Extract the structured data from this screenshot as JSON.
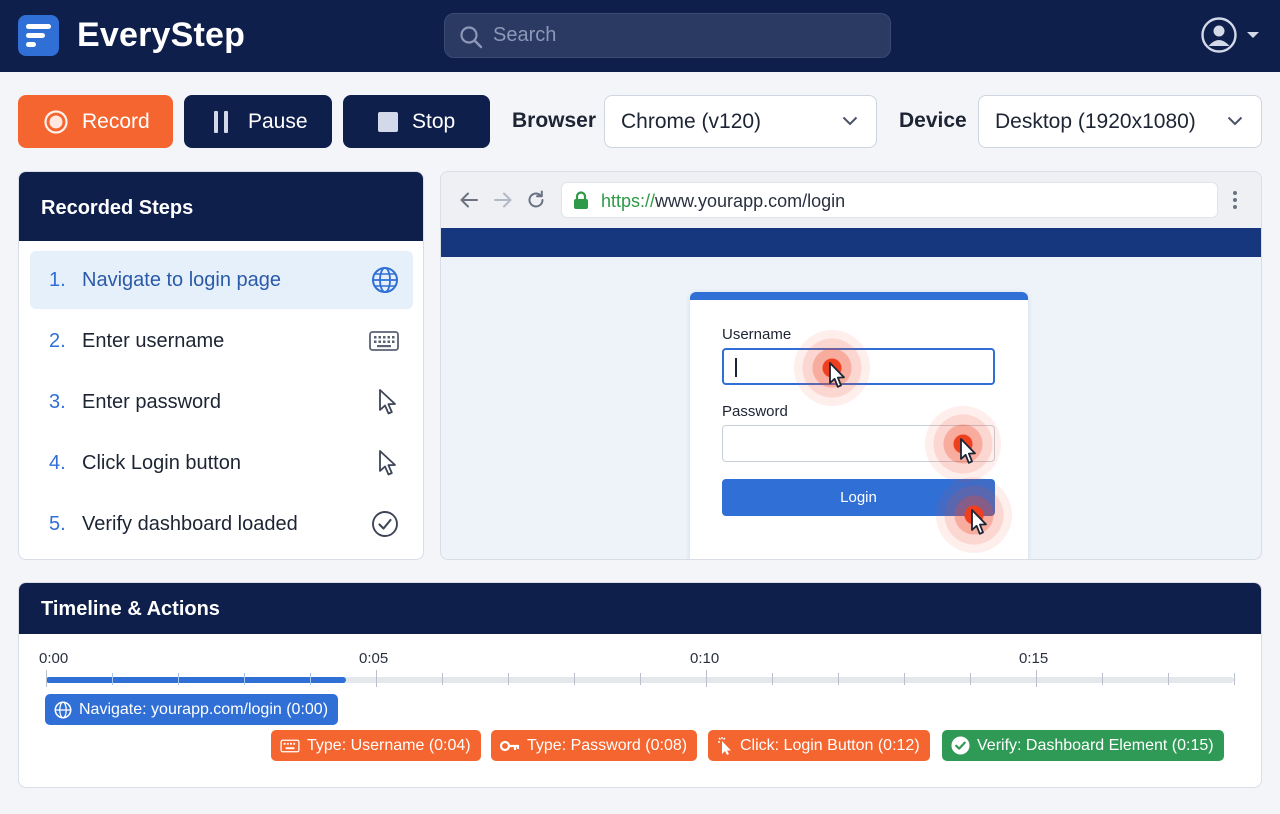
{
  "app": {
    "name": "EveryStep"
  },
  "header": {
    "search_placeholder": "Search"
  },
  "toolbar": {
    "record_label": "Record",
    "pause_label": "Pause",
    "stop_label": "Stop",
    "browser_label": "Browser",
    "browser_value": "Chrome (v120)",
    "device_label": "Device",
    "device_value": "Desktop (1920x1080)"
  },
  "steps": {
    "title": "Recorded Steps",
    "items": [
      {
        "num": "1.",
        "label": "Navigate to login page",
        "icon": "globe-icon",
        "active": true
      },
      {
        "num": "2.",
        "label": "Enter username",
        "icon": "keyboard-icon",
        "active": false
      },
      {
        "num": "3.",
        "label": "Enter password",
        "icon": "cursor-icon",
        "active": false
      },
      {
        "num": "4.",
        "label": "Click Login button",
        "icon": "cursor-icon",
        "active": false
      },
      {
        "num": "5.",
        "label": "Verify dashboard loaded",
        "icon": "check-circle-icon",
        "active": false
      }
    ]
  },
  "preview": {
    "url_scheme": "https://",
    "url_rest": "www.yourapp.com/login",
    "username_label": "Username",
    "password_label": "Password",
    "login_button": "Login"
  },
  "timeline": {
    "title": "Timeline & Actions",
    "ticks": [
      "0:00",
      "0:05",
      "0:10",
      "0:15"
    ],
    "actions": [
      {
        "label": "Navigate: yourapp.com/login (0:00)",
        "icon": "globe-icon",
        "color": "#2f6fd6"
      },
      {
        "label": "Type: Username (0:04)",
        "icon": "keyboard-icon",
        "color": "#f4652f"
      },
      {
        "label": "Type: Password (0:08)",
        "icon": "key-icon",
        "color": "#f4652f"
      },
      {
        "label": "Click: Login Button (0:12)",
        "icon": "click-icon",
        "color": "#f4652f"
      },
      {
        "label": "Verify: Dashboard Element (0:15)",
        "icon": "check-circle-icon",
        "color": "#2e9a55"
      }
    ]
  },
  "colors": {
    "navy": "#0f1f4b",
    "accent_blue": "#2f6fd6",
    "record_orange": "#f4652f",
    "success_green": "#2e9a55"
  }
}
